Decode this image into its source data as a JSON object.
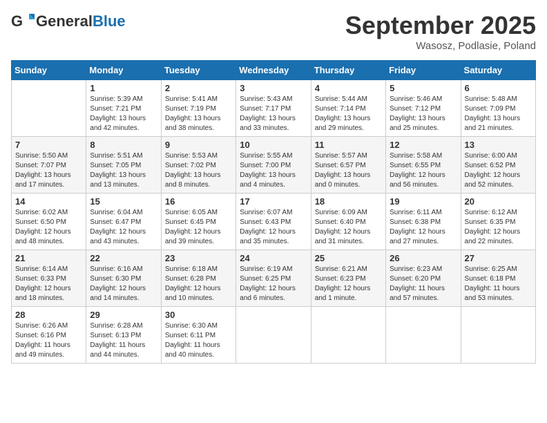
{
  "header": {
    "logo_general": "General",
    "logo_blue": "Blue",
    "month_title": "September 2025",
    "subtitle": "Wasosz, Podlasie, Poland"
  },
  "days_of_week": [
    "Sunday",
    "Monday",
    "Tuesday",
    "Wednesday",
    "Thursday",
    "Friday",
    "Saturday"
  ],
  "weeks": [
    [
      {
        "day": "",
        "sunrise": "",
        "sunset": "",
        "daylight": ""
      },
      {
        "day": "1",
        "sunrise": "Sunrise: 5:39 AM",
        "sunset": "Sunset: 7:21 PM",
        "daylight": "Daylight: 13 hours and 42 minutes."
      },
      {
        "day": "2",
        "sunrise": "Sunrise: 5:41 AM",
        "sunset": "Sunset: 7:19 PM",
        "daylight": "Daylight: 13 hours and 38 minutes."
      },
      {
        "day": "3",
        "sunrise": "Sunrise: 5:43 AM",
        "sunset": "Sunset: 7:17 PM",
        "daylight": "Daylight: 13 hours and 33 minutes."
      },
      {
        "day": "4",
        "sunrise": "Sunrise: 5:44 AM",
        "sunset": "Sunset: 7:14 PM",
        "daylight": "Daylight: 13 hours and 29 minutes."
      },
      {
        "day": "5",
        "sunrise": "Sunrise: 5:46 AM",
        "sunset": "Sunset: 7:12 PM",
        "daylight": "Daylight: 13 hours and 25 minutes."
      },
      {
        "day": "6",
        "sunrise": "Sunrise: 5:48 AM",
        "sunset": "Sunset: 7:09 PM",
        "daylight": "Daylight: 13 hours and 21 minutes."
      }
    ],
    [
      {
        "day": "7",
        "sunrise": "Sunrise: 5:50 AM",
        "sunset": "Sunset: 7:07 PM",
        "daylight": "Daylight: 13 hours and 17 minutes."
      },
      {
        "day": "8",
        "sunrise": "Sunrise: 5:51 AM",
        "sunset": "Sunset: 7:05 PM",
        "daylight": "Daylight: 13 hours and 13 minutes."
      },
      {
        "day": "9",
        "sunrise": "Sunrise: 5:53 AM",
        "sunset": "Sunset: 7:02 PM",
        "daylight": "Daylight: 13 hours and 8 minutes."
      },
      {
        "day": "10",
        "sunrise": "Sunrise: 5:55 AM",
        "sunset": "Sunset: 7:00 PM",
        "daylight": "Daylight: 13 hours and 4 minutes."
      },
      {
        "day": "11",
        "sunrise": "Sunrise: 5:57 AM",
        "sunset": "Sunset: 6:57 PM",
        "daylight": "Daylight: 13 hours and 0 minutes."
      },
      {
        "day": "12",
        "sunrise": "Sunrise: 5:58 AM",
        "sunset": "Sunset: 6:55 PM",
        "daylight": "Daylight: 12 hours and 56 minutes."
      },
      {
        "day": "13",
        "sunrise": "Sunrise: 6:00 AM",
        "sunset": "Sunset: 6:52 PM",
        "daylight": "Daylight: 12 hours and 52 minutes."
      }
    ],
    [
      {
        "day": "14",
        "sunrise": "Sunrise: 6:02 AM",
        "sunset": "Sunset: 6:50 PM",
        "daylight": "Daylight: 12 hours and 48 minutes."
      },
      {
        "day": "15",
        "sunrise": "Sunrise: 6:04 AM",
        "sunset": "Sunset: 6:47 PM",
        "daylight": "Daylight: 12 hours and 43 minutes."
      },
      {
        "day": "16",
        "sunrise": "Sunrise: 6:05 AM",
        "sunset": "Sunset: 6:45 PM",
        "daylight": "Daylight: 12 hours and 39 minutes."
      },
      {
        "day": "17",
        "sunrise": "Sunrise: 6:07 AM",
        "sunset": "Sunset: 6:43 PM",
        "daylight": "Daylight: 12 hours and 35 minutes."
      },
      {
        "day": "18",
        "sunrise": "Sunrise: 6:09 AM",
        "sunset": "Sunset: 6:40 PM",
        "daylight": "Daylight: 12 hours and 31 minutes."
      },
      {
        "day": "19",
        "sunrise": "Sunrise: 6:11 AM",
        "sunset": "Sunset: 6:38 PM",
        "daylight": "Daylight: 12 hours and 27 minutes."
      },
      {
        "day": "20",
        "sunrise": "Sunrise: 6:12 AM",
        "sunset": "Sunset: 6:35 PM",
        "daylight": "Daylight: 12 hours and 22 minutes."
      }
    ],
    [
      {
        "day": "21",
        "sunrise": "Sunrise: 6:14 AM",
        "sunset": "Sunset: 6:33 PM",
        "daylight": "Daylight: 12 hours and 18 minutes."
      },
      {
        "day": "22",
        "sunrise": "Sunrise: 6:16 AM",
        "sunset": "Sunset: 6:30 PM",
        "daylight": "Daylight: 12 hours and 14 minutes."
      },
      {
        "day": "23",
        "sunrise": "Sunrise: 6:18 AM",
        "sunset": "Sunset: 6:28 PM",
        "daylight": "Daylight: 12 hours and 10 minutes."
      },
      {
        "day": "24",
        "sunrise": "Sunrise: 6:19 AM",
        "sunset": "Sunset: 6:25 PM",
        "daylight": "Daylight: 12 hours and 6 minutes."
      },
      {
        "day": "25",
        "sunrise": "Sunrise: 6:21 AM",
        "sunset": "Sunset: 6:23 PM",
        "daylight": "Daylight: 12 hours and 1 minute."
      },
      {
        "day": "26",
        "sunrise": "Sunrise: 6:23 AM",
        "sunset": "Sunset: 6:20 PM",
        "daylight": "Daylight: 11 hours and 57 minutes."
      },
      {
        "day": "27",
        "sunrise": "Sunrise: 6:25 AM",
        "sunset": "Sunset: 6:18 PM",
        "daylight": "Daylight: 11 hours and 53 minutes."
      }
    ],
    [
      {
        "day": "28",
        "sunrise": "Sunrise: 6:26 AM",
        "sunset": "Sunset: 6:16 PM",
        "daylight": "Daylight: 11 hours and 49 minutes."
      },
      {
        "day": "29",
        "sunrise": "Sunrise: 6:28 AM",
        "sunset": "Sunset: 6:13 PM",
        "daylight": "Daylight: 11 hours and 44 minutes."
      },
      {
        "day": "30",
        "sunrise": "Sunrise: 6:30 AM",
        "sunset": "Sunset: 6:11 PM",
        "daylight": "Daylight: 11 hours and 40 minutes."
      },
      {
        "day": "",
        "sunrise": "",
        "sunset": "",
        "daylight": ""
      },
      {
        "day": "",
        "sunrise": "",
        "sunset": "",
        "daylight": ""
      },
      {
        "day": "",
        "sunrise": "",
        "sunset": "",
        "daylight": ""
      },
      {
        "day": "",
        "sunrise": "",
        "sunset": "",
        "daylight": ""
      }
    ]
  ]
}
